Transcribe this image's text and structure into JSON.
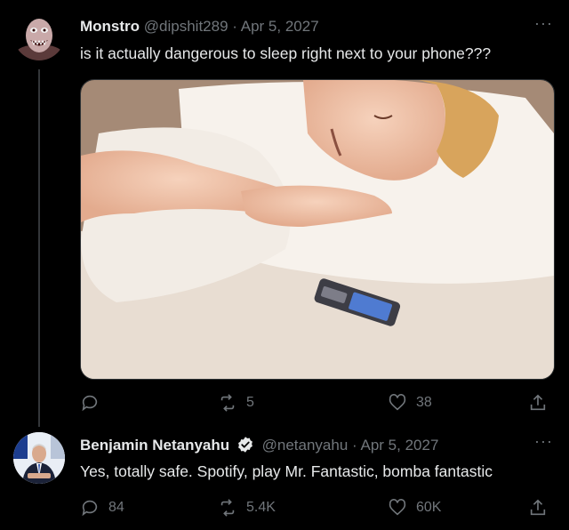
{
  "tweets": [
    {
      "display_name": "Monstro",
      "handle": "@dipshit289",
      "separator": "·",
      "date": "Apr 5, 2027",
      "text": "is it actually dangerous to sleep right next to your phone???",
      "more_label": "···",
      "reply_count": "",
      "retweet_count": "5",
      "like_count": "38",
      "has_media": true,
      "verified": false
    },
    {
      "display_name": "Benjamin Netanyahu",
      "handle": "@netanyahu",
      "separator": "·",
      "date": "Apr 5, 2027",
      "text": "Yes, totally safe. Spotify, play Mr. Fantastic, bomba fantastic",
      "more_label": "···",
      "reply_count": "84",
      "retweet_count": "5.4K",
      "like_count": "60K",
      "verified": true
    }
  ],
  "colors": {
    "background": "#000000",
    "primary_text": "#e7e9ea",
    "secondary_text": "#71767b",
    "thread_line": "#333639"
  },
  "icons": [
    "reply-icon",
    "retweet-icon",
    "like-icon",
    "share-icon",
    "verified-badge-icon",
    "more-icon"
  ]
}
